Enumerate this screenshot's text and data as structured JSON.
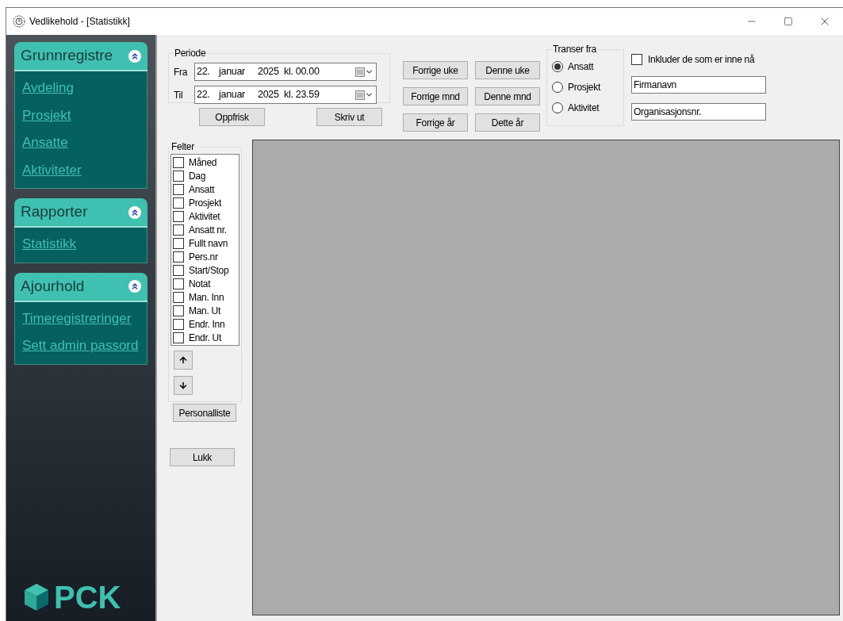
{
  "window": {
    "title": "Vedlikehold - [Statistikk]"
  },
  "sidebar": {
    "groups": [
      {
        "title": "Grunnregistre",
        "expanded": true,
        "items": [
          "Avdeling",
          "Prosjekt",
          "Ansatte",
          "Aktiviteter"
        ]
      },
      {
        "title": "Rapporter",
        "expanded": true,
        "items": [
          "Statistikk"
        ]
      },
      {
        "title": "Ajourhold",
        "expanded": true,
        "items": [
          "Timeregistreringer",
          "Sett admin passord"
        ]
      }
    ],
    "logo": "PCK"
  },
  "periode": {
    "title": "Periode",
    "rows": [
      {
        "label": "Fra",
        "day": "22.",
        "month": "januar",
        "year": "2025",
        "time": "kl. 00.00"
      },
      {
        "label": "Til",
        "day": "22.",
        "month": "januar",
        "year": "2025",
        "time": "kl. 23.59"
      }
    ]
  },
  "action_buttons": [
    "Oppfrisk",
    "Skriv ut"
  ],
  "quick_buttons": [
    [
      "Forrige uke",
      "Denne uke"
    ],
    [
      "Forrige mnd",
      "Denne mnd"
    ],
    [
      "Forrige år",
      "Dette år"
    ]
  ],
  "transer_fra": {
    "title": "Transer fra",
    "options": [
      {
        "label": "Ansatt",
        "selected": true
      },
      {
        "label": "Prosjekt",
        "selected": false
      },
      {
        "label": "Aktivitet",
        "selected": false
      }
    ]
  },
  "include_now": {
    "label": "Inkluder de som er inne nå",
    "checked": false
  },
  "fields": [
    {
      "value": "Firmanavn"
    },
    {
      "value": "Organisasjonsnr."
    }
  ],
  "felter": {
    "title": "Felter",
    "items": [
      {
        "label": "Måned",
        "checked": false
      },
      {
        "label": "Dag",
        "checked": false
      },
      {
        "label": "Ansatt",
        "checked": false
      },
      {
        "label": "Prosjekt",
        "checked": false
      },
      {
        "label": "Aktivitet",
        "checked": false
      },
      {
        "label": "Ansatt nr.",
        "checked": false
      },
      {
        "label": "Fullt navn",
        "checked": false
      },
      {
        "label": "Pers.nr",
        "checked": false
      },
      {
        "label": "Start/Stop",
        "checked": false
      },
      {
        "label": "Notat",
        "checked": false
      },
      {
        "label": "Man. Inn",
        "checked": false
      },
      {
        "label": "Man. Ut",
        "checked": false
      },
      {
        "label": "Endr. Inn",
        "checked": false
      },
      {
        "label": "Endr. Ut",
        "checked": false
      }
    ]
  },
  "personalliste_button": "Personalliste",
  "close_button": "Lukk"
}
